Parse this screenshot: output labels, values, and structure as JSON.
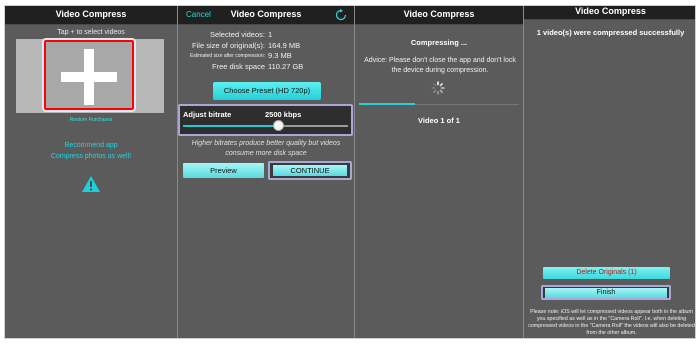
{
  "screen1": {
    "title": "Video Compress",
    "hint": "Tap + to select videos",
    "add_icon": "plus-icon",
    "restore": "Restore Purchases",
    "recommend_line1": "Recommend app",
    "recommend_line2": "Compress photos as well!",
    "warning_icon": "warning-icon"
  },
  "screen2": {
    "cancel": "Cancel",
    "title": "Video Compress",
    "refresh_icon": "refresh-icon",
    "info": [
      {
        "label": "Selected videos:",
        "value": "1"
      },
      {
        "label": "File size of original(s):",
        "value": "164.9 MB"
      },
      {
        "label": "Estimated size after compression:",
        "value": "9.3 MB"
      },
      {
        "label": "Free disk space",
        "value": "110.27 GB"
      }
    ],
    "preset_button": "Choose Preset (HD 720p)",
    "bitrate_label": "Adjust bitrate",
    "bitrate_value": "2500 kbps",
    "bitrate_fraction": 0.58,
    "note": "Higher bitrates produce better quality but videos consume more disk space",
    "preview_button": "Preview",
    "continue_button": "CONTINUE"
  },
  "screen3": {
    "title": "Video Compress",
    "status": "Compressing ...",
    "advice": "Advice: Please don't close the app and don't lock the device during compression.",
    "spinner_icon": "spinner-icon",
    "progress_fraction": 0.35,
    "video_of": "Video 1 of 1"
  },
  "screen4": {
    "title": "Video Compress",
    "success": "1 video(s) were compressed successfully",
    "delete_button": "Delete Originals (1)",
    "finish_button": "Finish",
    "disclaimer": "Please note: iOS will let compressed videos appear both in the album you specified as well as in the \"Camera Roll\". I.e. when deleting compressed videos in the \"Camera Roll\" the videos will also be deleted from the other album."
  }
}
